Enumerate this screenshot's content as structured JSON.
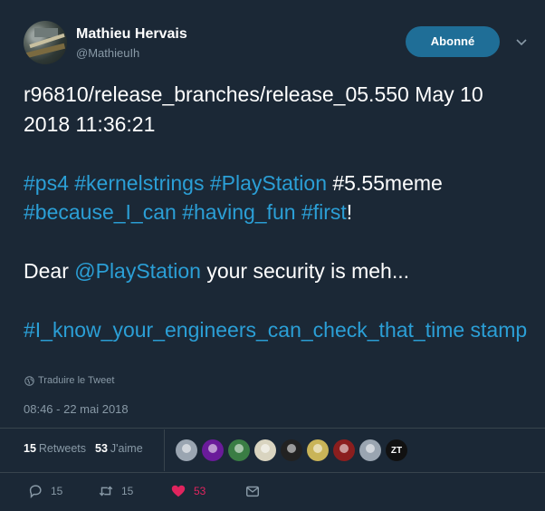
{
  "user": {
    "name": "Mathieu Hervais",
    "handle": "@MathieuIh"
  },
  "follow_button": "Abonné",
  "tweet": {
    "segments": [
      {
        "text": "r96810/release_branches/release_05.550 May 10 2018 11:36:21\n\n",
        "link": false
      },
      {
        "text": "#ps4",
        "link": true
      },
      {
        "text": " ",
        "link": false
      },
      {
        "text": "#kernelstrings",
        "link": true
      },
      {
        "text": " ",
        "link": false
      },
      {
        "text": "#PlayStation",
        "link": true
      },
      {
        "text": " #5.55meme ",
        "link": false
      },
      {
        "text": "#because_I_can",
        "link": true
      },
      {
        "text": " ",
        "link": false
      },
      {
        "text": "#having_fun",
        "link": true
      },
      {
        "text": " ",
        "link": false
      },
      {
        "text": "#first",
        "link": true
      },
      {
        "text": "!\n\nDear ",
        "link": false
      },
      {
        "text": "@PlayStation",
        "link": true
      },
      {
        "text": " your security is meh...\n\n",
        "link": false
      },
      {
        "text": "#I_know_your_engineers_can_check_that_time stamp",
        "link": true
      }
    ]
  },
  "translate_label": "Traduire le Tweet",
  "timestamp": "08:46 - 22 mai 2018",
  "stats": {
    "retweets_count": "15",
    "retweets_label": "Retweets",
    "likes_count": "53",
    "likes_label": "J'aime"
  },
  "likers": [
    {
      "color": "#9aa5b1",
      "icon": "default-avatar"
    },
    {
      "color": "#6a1b9a",
      "icon": "purple-avatar"
    },
    {
      "color": "#3a7d44",
      "icon": "green-avatar"
    },
    {
      "color": "#d9d4c0",
      "icon": "cartoon-avatar"
    },
    {
      "color": "#222222",
      "icon": "mask-avatar"
    },
    {
      "color": "#c9b458",
      "icon": "yellow-avatar"
    },
    {
      "color": "#8b1e1e",
      "icon": "red-avatar"
    },
    {
      "color": "#9aa5b1",
      "icon": "default-avatar"
    },
    {
      "color": "#111111",
      "icon": "zt-logo-avatar",
      "text": "ZT"
    }
  ],
  "actions": {
    "reply_count": "15",
    "retweet_count": "15",
    "like_count": "53"
  },
  "colors": {
    "background": "#1b2836",
    "link": "#2b9fd6",
    "secondary": "#8899a6",
    "like": "#e0245e",
    "button": "#1f6e97"
  }
}
